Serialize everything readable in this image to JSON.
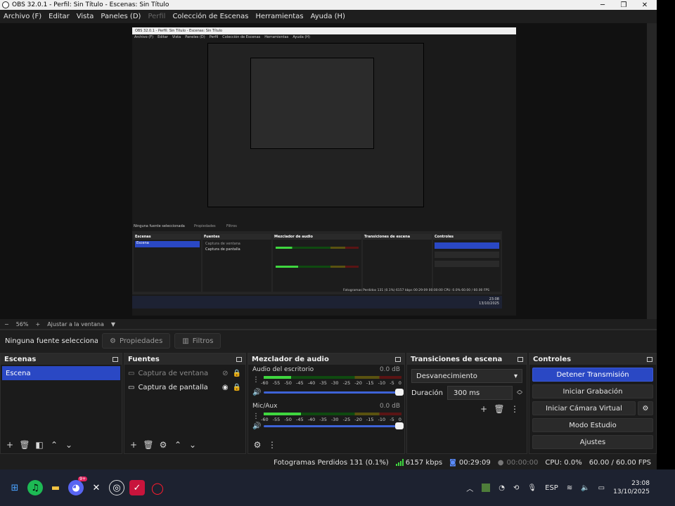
{
  "window": {
    "title": "OBS 32.0.1 - Perfil: Sin Título - Escenas: Sin Título",
    "controls": {
      "minimize": "─",
      "maximize": "❐",
      "close": "✕"
    }
  },
  "menu": {
    "items": [
      "Archivo (F)",
      "Editar",
      "Vista",
      "Paneles (D)",
      "Perfil",
      "Colección de Escenas",
      "Herramientas",
      "Ayuda (H)"
    ]
  },
  "preview": {
    "nested_title": "OBS 32.0.1 - Perfil: Sin Título - Escenas: Sin Título",
    "nested_menu": [
      "Archivo (F)",
      "Editar",
      "Vista",
      "Paneles (D)",
      "Perfil",
      "Colección de Escenas",
      "Herramientas",
      "Ayuda (H)"
    ],
    "nested_no_source": "Ninguna fuente seleccionada",
    "nested_props": "Propiedades",
    "nested_filters": "Filtros",
    "nested_docks": [
      "Escenas",
      "Fuentes",
      "Mezclador de audio",
      "Transiciones de escena",
      "Controles"
    ],
    "nested_scene": "Escena",
    "nested_sources": [
      "Captura de ventana",
      "Captura de pantalla"
    ],
    "nested_status": "Fotogramas Perdidos 131 (0.1%)   6157 kbps   00:29:09   00:00:00   CPU: 0.0%   60.00 / 60.00 FPS",
    "nested_time": "23:08",
    "nested_date": "13/10/2025"
  },
  "zoom": {
    "minus": "−",
    "level": "56%",
    "plus": "+",
    "fit": "Ajustar a la ventana",
    "caret": "▼"
  },
  "properties_bar": {
    "no_source": "Ninguna fuente seleccionada",
    "properties": "Propiedades",
    "filters": "Filtros"
  },
  "scenes": {
    "title": "Escenas",
    "items": [
      "Escena"
    ]
  },
  "sources": {
    "title": "Fuentes",
    "items": [
      {
        "name": "Captura de ventana",
        "hidden": true
      },
      {
        "name": "Captura de pantalla",
        "hidden": false
      }
    ]
  },
  "mixer": {
    "title": "Mezclador de audio",
    "channels": [
      {
        "name": "Audio del escritorio",
        "db": "0.0 dB",
        "level": 0.2
      },
      {
        "name": "Mic/Aux",
        "db": "0.0 dB",
        "level": 0.27
      }
    ],
    "ticks": [
      "-60",
      "-55",
      "-50",
      "-45",
      "-40",
      "-35",
      "-30",
      "-25",
      "-20",
      "-15",
      "-10",
      "-5",
      "0"
    ]
  },
  "transitions": {
    "title": "Transiciones de escena",
    "selected": "Desvanecimiento",
    "duration_label": "Duración",
    "duration_value": "300 ms"
  },
  "controls": {
    "title": "Controles",
    "stop_stream": "Detener Transmisión",
    "start_record": "Iniciar Grabación",
    "start_vcam": "Iniciar Cámara Virtual",
    "studio_mode": "Modo Estudio",
    "settings": "Ajustes"
  },
  "status": {
    "dropped": "Fotogramas Perdidos 131 (0.1%)",
    "bitrate": "6157 kbps",
    "stream_time": "00:29:09",
    "record_time": "00:00:00",
    "cpu": "CPU: 0.0%",
    "fps": "60.00 / 60.00 FPS"
  },
  "taskbar": {
    "lang": "ESP",
    "time": "23:08",
    "date": "13/10/2025",
    "discord_badge": "9+"
  },
  "colors": {
    "accent": "#2a48c4",
    "bg": "#1e1e1e",
    "dock": "#1b1b1b",
    "meter_green": "#3fd63f"
  }
}
